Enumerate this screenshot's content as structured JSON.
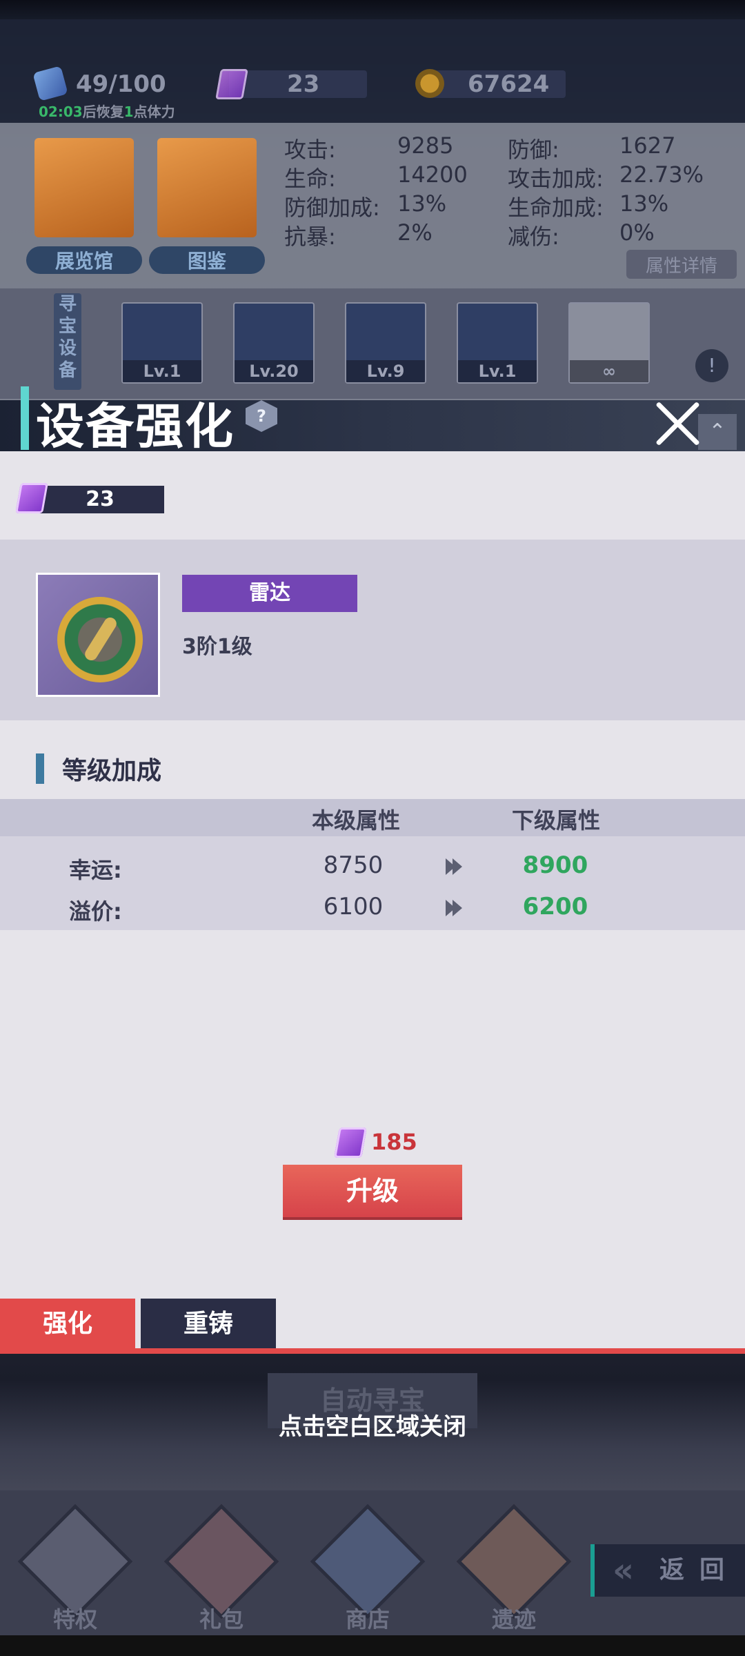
{
  "resources": {
    "stamina": "49/100",
    "stamina_timer_time": "02:03",
    "stamina_timer_mid": "后恢复",
    "stamina_timer_num": "1",
    "stamina_timer_tail": "点体力",
    "gems": "23",
    "coins": "67624"
  },
  "buildings": [
    {
      "label": "展览馆"
    },
    {
      "label": "图鉴"
    }
  ],
  "stats": [
    {
      "label": "攻击:",
      "value": "9285"
    },
    {
      "label": "防御:",
      "value": "1627"
    },
    {
      "label": "生命:",
      "value": "14200"
    },
    {
      "label": "攻击加成:",
      "value": "22.73%"
    },
    {
      "label": "防御加成:",
      "value": "13%"
    },
    {
      "label": "生命加成:",
      "value": "13%"
    },
    {
      "label": "抗暴:",
      "value": "2%"
    },
    {
      "label": "减伤:",
      "value": "0%"
    }
  ],
  "attr_detail_label": "属性详情",
  "equip_side_label": "寻宝设备",
  "equipment": [
    {
      "level": "Lv.1"
    },
    {
      "level": "Lv.20"
    },
    {
      "level": "Lv.9"
    },
    {
      "level": "Lv.1"
    },
    {
      "level": "∞"
    }
  ],
  "info_icon": "!",
  "modal": {
    "title": "设备强化",
    "help": "?",
    "collapse": "⌃",
    "currency": "23",
    "item": {
      "name": "雷达",
      "tier": "3阶1级"
    },
    "section_title": "等级加成",
    "columns": {
      "current": "本级属性",
      "next": "下级属性"
    },
    "rows": [
      {
        "label": "幸运:",
        "current": "8750",
        "next": "8900"
      },
      {
        "label": "溢价:",
        "current": "6100",
        "next": "6200"
      }
    ],
    "cost": "185",
    "upgrade_label": "升级",
    "tabs": {
      "enhance": "强化",
      "reforge": "重铸"
    }
  },
  "auto_treasure": "自动寻宝",
  "close_hint": "点击空白区域关闭",
  "nav": [
    {
      "label": "特权"
    },
    {
      "label": "礼包"
    },
    {
      "label": "商店"
    },
    {
      "label": "遗迹"
    }
  ],
  "back_label": "返回",
  "colors": {
    "accent_teal": "#5fd6d0",
    "item_purple": "#7345b4",
    "upgrade_red": "#e24a4a",
    "next_green": "#2fa65e",
    "cost_red": "#c9343a"
  }
}
